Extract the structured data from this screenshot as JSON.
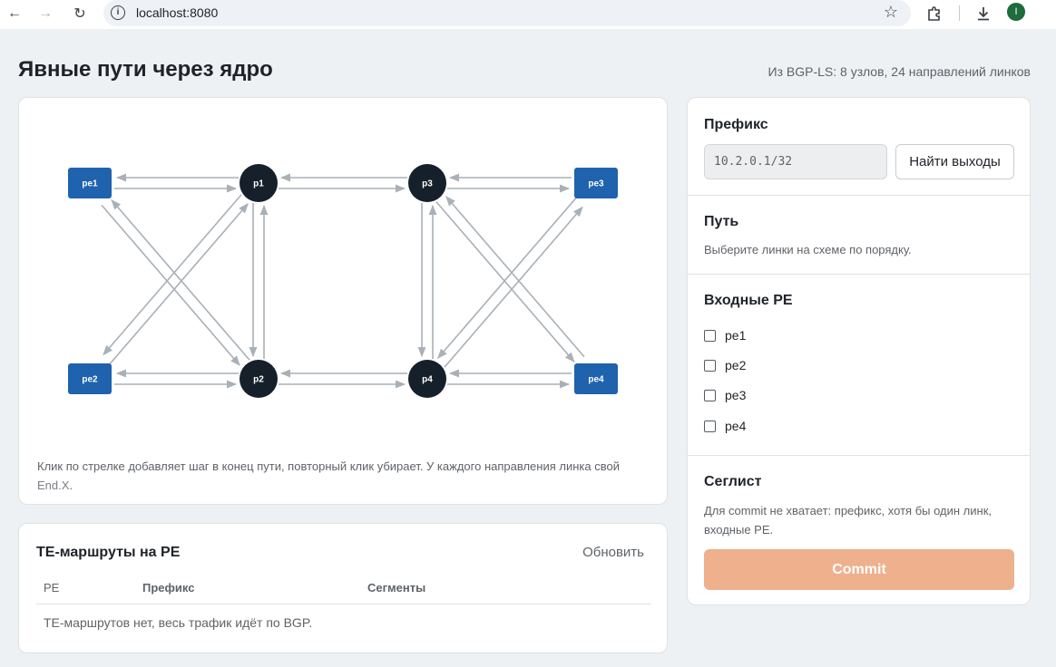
{
  "browser": {
    "url": "localhost:8080",
    "avatar_letter": "I"
  },
  "header": {
    "title": "Явные пути через ядро",
    "summary": "Из BGP-LS: 8 узлов, 24 направлений линков"
  },
  "graph": {
    "nodes": [
      {
        "id": "pe1",
        "label": "pe1",
        "kind": "pe"
      },
      {
        "id": "p1",
        "label": "p1",
        "kind": "p"
      },
      {
        "id": "p3",
        "label": "p3",
        "kind": "p"
      },
      {
        "id": "pe3",
        "label": "pe3",
        "kind": "pe"
      },
      {
        "id": "pe2",
        "label": "pe2",
        "kind": "pe"
      },
      {
        "id": "p2",
        "label": "p2",
        "kind": "p"
      },
      {
        "id": "p4",
        "label": "p4",
        "kind": "p"
      },
      {
        "id": "pe4",
        "label": "pe4",
        "kind": "pe"
      }
    ],
    "links": [
      {
        "from": "pe1",
        "to": "p1"
      },
      {
        "from": "p1",
        "to": "pe1"
      },
      {
        "from": "pe1",
        "to": "p2"
      },
      {
        "from": "p2",
        "to": "pe1"
      },
      {
        "from": "pe2",
        "to": "p1"
      },
      {
        "from": "p1",
        "to": "pe2"
      },
      {
        "from": "pe2",
        "to": "p2"
      },
      {
        "from": "p2",
        "to": "pe2"
      },
      {
        "from": "p1",
        "to": "p3"
      },
      {
        "from": "p3",
        "to": "p1"
      },
      {
        "from": "p1",
        "to": "p2"
      },
      {
        "from": "p2",
        "to": "p1"
      },
      {
        "from": "p2",
        "to": "p4"
      },
      {
        "from": "p4",
        "to": "p2"
      },
      {
        "from": "p3",
        "to": "p4"
      },
      {
        "from": "p4",
        "to": "p3"
      },
      {
        "from": "p3",
        "to": "pe3"
      },
      {
        "from": "pe3",
        "to": "p3"
      },
      {
        "from": "p3",
        "to": "pe4"
      },
      {
        "from": "pe4",
        "to": "p3"
      },
      {
        "from": "p4",
        "to": "pe3"
      },
      {
        "from": "pe3",
        "to": "p4"
      },
      {
        "from": "p4",
        "to": "pe4"
      },
      {
        "from": "pe4",
        "to": "p4"
      }
    ],
    "note_main": "Клик по стрелке добавляет шаг в конец пути, повторный клик убирает. У каждого направления линка свой ",
    "note_endx": "End.X",
    "note_end": "."
  },
  "routes": {
    "title": "TE-маршруты на PE",
    "refresh_label": "Обновить",
    "columns": [
      "PE",
      "Префикс",
      "Сегменты"
    ],
    "empty_text": "TE-маршрутов нет, весь трафик идёт по BGP."
  },
  "side": {
    "prefix_title": "Префикс",
    "prefix_value": "10.2.0.1/32",
    "find_button": "Найти выходы",
    "path_title": "Путь",
    "path_hint": "Выберите линки на схеме по порядку.",
    "pe_title": "Входные PE",
    "pe_options": [
      {
        "label": "pe1",
        "checked": false
      },
      {
        "label": "pe2",
        "checked": false
      },
      {
        "label": "pe3",
        "checked": false
      },
      {
        "label": "pe4",
        "checked": false
      }
    ],
    "seglist_title": "Сеглист",
    "seglist_hint": "Для commit не хватает: префикс, хотя бы один линк, входные PE.",
    "commit_label": "Commit",
    "commit_color": "#eeb08d"
  }
}
